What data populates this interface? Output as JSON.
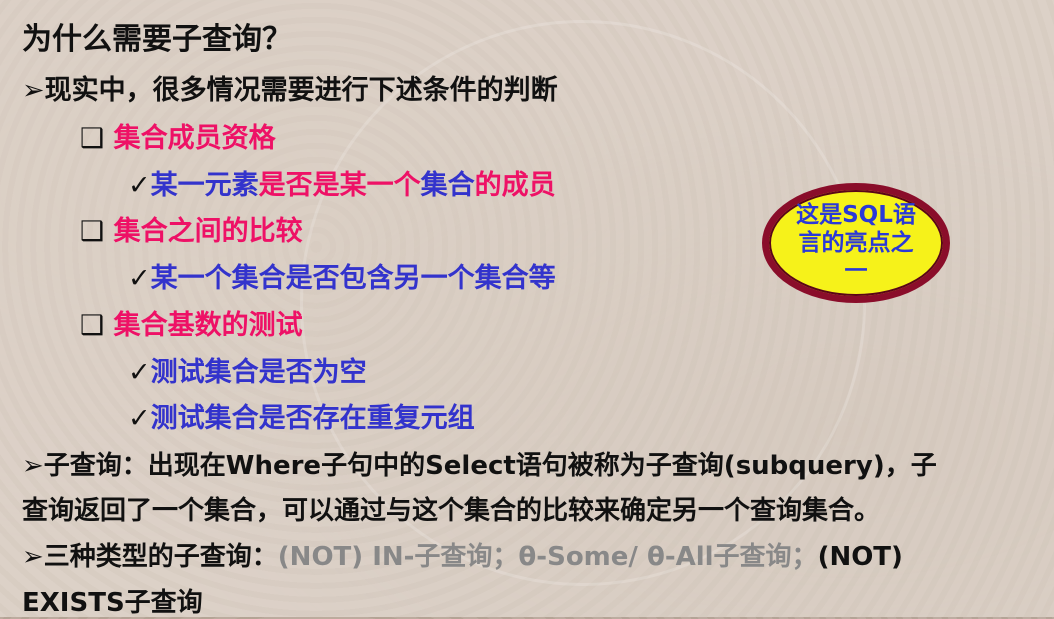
{
  "title": "为什么需要子查询？",
  "bullets": {
    "b1": "➢现实中，很多情况需要进行下述条件的判断",
    "b2_part1": "➢子查询：出现在Where子句中的Select语句被称为子查询(subquery)，子",
    "b2_part2": "查询返回了一个集合，可以通过与这个集合的比较来确定另一个查询集合。",
    "b3_prefix": "➢三种类型的子查询：",
    "b3_gray": "(NOT) IN-子查询；θ-Some/ θ-All子查询；",
    "b3_suffix": "(NOT)",
    "b3_line2": "EXISTS子查询"
  },
  "sections": [
    {
      "marker": "❑",
      "label": "集合成员资格"
    },
    {
      "marker": "❑",
      "label": "集合之间的比较"
    },
    {
      "marker": "❑",
      "label": "集合基数的测试"
    }
  ],
  "checks": {
    "c1_a": "某一元素",
    "c1_b": "是否是某一个",
    "c1_c": "集合",
    "c1_d": "的成员",
    "c2": "某一个集合是否包含另一个集合等",
    "c3": "测试集合是否为空",
    "c4": "测试集合是否存在重复元组",
    "check_mark": "✓"
  },
  "callout": "这是SQL语言的亮点之一",
  "colors": {
    "pink": "#ee1166",
    "blue": "#3333cc",
    "gray": "#888888",
    "callout_fill": "#f6f21a",
    "callout_border": "#8a0d2a"
  }
}
